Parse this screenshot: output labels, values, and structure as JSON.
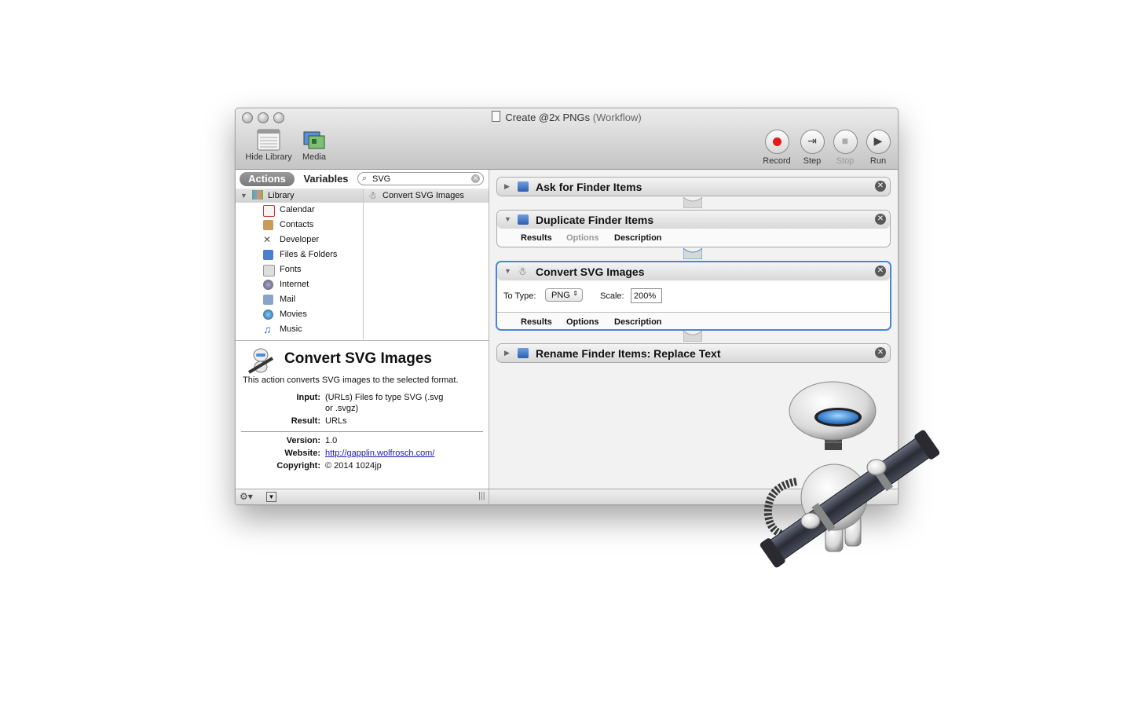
{
  "window": {
    "title": "Create @2x PNGs",
    "title_kind": "(Workflow)"
  },
  "toolbar": {
    "hide_library": "Hide Library",
    "media": "Media",
    "record": "Record",
    "step": "Step",
    "stop": "Stop",
    "run": "Run"
  },
  "library": {
    "tab_actions": "Actions",
    "tab_variables": "Variables",
    "search_value": "SVG",
    "root": "Library",
    "items": [
      "Calendar",
      "Contacts",
      "Developer",
      "Files & Folders",
      "Fonts",
      "Internet",
      "Mail",
      "Movies",
      "Music"
    ],
    "results": [
      "Convert SVG Images"
    ]
  },
  "description": {
    "title": "Convert SVG Images",
    "summary": "This action converts SVG images to the selected format.",
    "input_label": "Input:",
    "input_value_1": "(URLs) Files fo type SVG (.svg",
    "input_value_2": "or .svgz)",
    "result_label": "Result:",
    "result_value": "URLs",
    "version_label": "Version:",
    "version_value": "1.0",
    "website_label": "Website:",
    "website_value": "http://gapplin.wolfrosch.com/",
    "copyright_label": "Copyright:",
    "copyright_value": "© 2014 1024jp"
  },
  "workflow": {
    "actions": [
      {
        "name": "Ask for Finder Items"
      },
      {
        "name": "Duplicate Finder Items",
        "tabs": [
          "Results",
          "Options",
          "Description"
        ]
      },
      {
        "name": "Convert SVG Images",
        "to_type_label": "To Type:",
        "to_type_value": "PNG",
        "scale_label": "Scale:",
        "scale_value": "200%",
        "tabs": [
          "Results",
          "Options",
          "Description"
        ]
      },
      {
        "name": "Rename Finder Items: Replace Text"
      }
    ]
  },
  "colors": {
    "record": "#e4191c",
    "selection": "#4a86d8"
  }
}
